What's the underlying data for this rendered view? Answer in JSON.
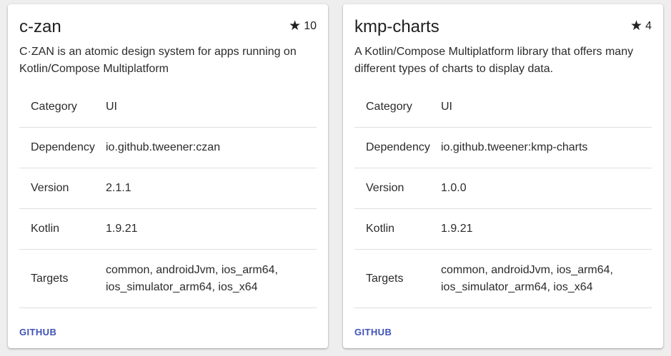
{
  "cards": [
    {
      "title": "c-zan",
      "stars": "10",
      "description": "C·ZAN is an atomic design system for apps running on Kotlin/Compose Multiplatform",
      "details": {
        "category_label": "Category",
        "category": "UI",
        "dependency_label": "Dependency",
        "dependency": "io.github.tweener:czan",
        "version_label": "Version",
        "version": "2.1.1",
        "kotlin_label": "Kotlin",
        "kotlin": "1.9.21",
        "targets_label": "Targets",
        "targets": "common, androidJvm, ios_arm64, ios_simulator_arm64, ios_x64"
      },
      "link_label": "GITHUB"
    },
    {
      "title": "kmp-charts",
      "stars": "4",
      "description": "A Kotlin/Compose Multiplatform library that offers many different types of charts to display data.",
      "details": {
        "category_label": "Category",
        "category": "UI",
        "dependency_label": "Dependency",
        "dependency": "io.github.tweener:kmp-charts",
        "version_label": "Version",
        "version": "1.0.0",
        "kotlin_label": "Kotlin",
        "kotlin": "1.9.21",
        "targets_label": "Targets",
        "targets": "common, androidJvm, ios_arm64, ios_simulator_arm64, ios_x64"
      },
      "link_label": "GITHUB"
    }
  ],
  "icons": {
    "star": "star-icon"
  },
  "colors": {
    "background": "#eeeeee",
    "card": "#ffffff",
    "link": "#3f51b5",
    "divider": "#e0e0e0"
  }
}
